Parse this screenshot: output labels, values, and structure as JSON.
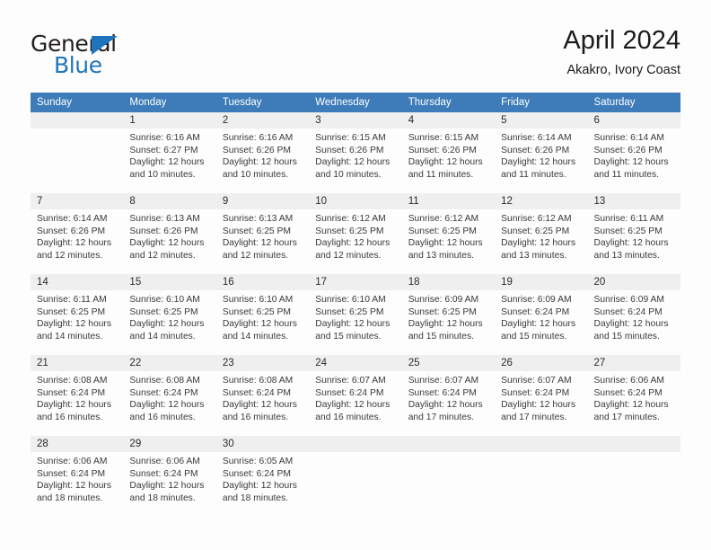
{
  "brand": {
    "name_top": "General",
    "name_bottom": "Blue",
    "triangle_color": "#1f74bb"
  },
  "header": {
    "month_title": "April 2024",
    "location": "Akakro, Ivory Coast"
  },
  "theme": {
    "header_blue": "#3d7cb8",
    "separator_blue": "#2f6fad",
    "daynum_band": "#efefef",
    "page_background": "#fdfdfd"
  },
  "calendar": {
    "weekday_headers": [
      "Sunday",
      "Monday",
      "Tuesday",
      "Wednesday",
      "Thursday",
      "Friday",
      "Saturday"
    ],
    "weeks": [
      [
        {
          "day": "",
          "blank": true,
          "sunrise": "",
          "sunset": "",
          "daylight_line1": "",
          "daylight_line2": ""
        },
        {
          "day": "1",
          "sunrise": "Sunrise: 6:16 AM",
          "sunset": "Sunset: 6:27 PM",
          "daylight_line1": "Daylight: 12 hours",
          "daylight_line2": "and 10 minutes."
        },
        {
          "day": "2",
          "sunrise": "Sunrise: 6:16 AM",
          "sunset": "Sunset: 6:26 PM",
          "daylight_line1": "Daylight: 12 hours",
          "daylight_line2": "and 10 minutes."
        },
        {
          "day": "3",
          "sunrise": "Sunrise: 6:15 AM",
          "sunset": "Sunset: 6:26 PM",
          "daylight_line1": "Daylight: 12 hours",
          "daylight_line2": "and 10 minutes."
        },
        {
          "day": "4",
          "sunrise": "Sunrise: 6:15 AM",
          "sunset": "Sunset: 6:26 PM",
          "daylight_line1": "Daylight: 12 hours",
          "daylight_line2": "and 11 minutes."
        },
        {
          "day": "5",
          "sunrise": "Sunrise: 6:14 AM",
          "sunset": "Sunset: 6:26 PM",
          "daylight_line1": "Daylight: 12 hours",
          "daylight_line2": "and 11 minutes."
        },
        {
          "day": "6",
          "sunrise": "Sunrise: 6:14 AM",
          "sunset": "Sunset: 6:26 PM",
          "daylight_line1": "Daylight: 12 hours",
          "daylight_line2": "and 11 minutes."
        }
      ],
      [
        {
          "day": "7",
          "sunrise": "Sunrise: 6:14 AM",
          "sunset": "Sunset: 6:26 PM",
          "daylight_line1": "Daylight: 12 hours",
          "daylight_line2": "and 12 minutes."
        },
        {
          "day": "8",
          "sunrise": "Sunrise: 6:13 AM",
          "sunset": "Sunset: 6:26 PM",
          "daylight_line1": "Daylight: 12 hours",
          "daylight_line2": "and 12 minutes."
        },
        {
          "day": "9",
          "sunrise": "Sunrise: 6:13 AM",
          "sunset": "Sunset: 6:25 PM",
          "daylight_line1": "Daylight: 12 hours",
          "daylight_line2": "and 12 minutes."
        },
        {
          "day": "10",
          "sunrise": "Sunrise: 6:12 AM",
          "sunset": "Sunset: 6:25 PM",
          "daylight_line1": "Daylight: 12 hours",
          "daylight_line2": "and 12 minutes."
        },
        {
          "day": "11",
          "sunrise": "Sunrise: 6:12 AM",
          "sunset": "Sunset: 6:25 PM",
          "daylight_line1": "Daylight: 12 hours",
          "daylight_line2": "and 13 minutes."
        },
        {
          "day": "12",
          "sunrise": "Sunrise: 6:12 AM",
          "sunset": "Sunset: 6:25 PM",
          "daylight_line1": "Daylight: 12 hours",
          "daylight_line2": "and 13 minutes."
        },
        {
          "day": "13",
          "sunrise": "Sunrise: 6:11 AM",
          "sunset": "Sunset: 6:25 PM",
          "daylight_line1": "Daylight: 12 hours",
          "daylight_line2": "and 13 minutes."
        }
      ],
      [
        {
          "day": "14",
          "sunrise": "Sunrise: 6:11 AM",
          "sunset": "Sunset: 6:25 PM",
          "daylight_line1": "Daylight: 12 hours",
          "daylight_line2": "and 14 minutes."
        },
        {
          "day": "15",
          "sunrise": "Sunrise: 6:10 AM",
          "sunset": "Sunset: 6:25 PM",
          "daylight_line1": "Daylight: 12 hours",
          "daylight_line2": "and 14 minutes."
        },
        {
          "day": "16",
          "sunrise": "Sunrise: 6:10 AM",
          "sunset": "Sunset: 6:25 PM",
          "daylight_line1": "Daylight: 12 hours",
          "daylight_line2": "and 14 minutes."
        },
        {
          "day": "17",
          "sunrise": "Sunrise: 6:10 AM",
          "sunset": "Sunset: 6:25 PM",
          "daylight_line1": "Daylight: 12 hours",
          "daylight_line2": "and 15 minutes."
        },
        {
          "day": "18",
          "sunrise": "Sunrise: 6:09 AM",
          "sunset": "Sunset: 6:25 PM",
          "daylight_line1": "Daylight: 12 hours",
          "daylight_line2": "and 15 minutes."
        },
        {
          "day": "19",
          "sunrise": "Sunrise: 6:09 AM",
          "sunset": "Sunset: 6:24 PM",
          "daylight_line1": "Daylight: 12 hours",
          "daylight_line2": "and 15 minutes."
        },
        {
          "day": "20",
          "sunrise": "Sunrise: 6:09 AM",
          "sunset": "Sunset: 6:24 PM",
          "daylight_line1": "Daylight: 12 hours",
          "daylight_line2": "and 15 minutes."
        }
      ],
      [
        {
          "day": "21",
          "sunrise": "Sunrise: 6:08 AM",
          "sunset": "Sunset: 6:24 PM",
          "daylight_line1": "Daylight: 12 hours",
          "daylight_line2": "and 16 minutes."
        },
        {
          "day": "22",
          "sunrise": "Sunrise: 6:08 AM",
          "sunset": "Sunset: 6:24 PM",
          "daylight_line1": "Daylight: 12 hours",
          "daylight_line2": "and 16 minutes."
        },
        {
          "day": "23",
          "sunrise": "Sunrise: 6:08 AM",
          "sunset": "Sunset: 6:24 PM",
          "daylight_line1": "Daylight: 12 hours",
          "daylight_line2": "and 16 minutes."
        },
        {
          "day": "24",
          "sunrise": "Sunrise: 6:07 AM",
          "sunset": "Sunset: 6:24 PM",
          "daylight_line1": "Daylight: 12 hours",
          "daylight_line2": "and 16 minutes."
        },
        {
          "day": "25",
          "sunrise": "Sunrise: 6:07 AM",
          "sunset": "Sunset: 6:24 PM",
          "daylight_line1": "Daylight: 12 hours",
          "daylight_line2": "and 17 minutes."
        },
        {
          "day": "26",
          "sunrise": "Sunrise: 6:07 AM",
          "sunset": "Sunset: 6:24 PM",
          "daylight_line1": "Daylight: 12 hours",
          "daylight_line2": "and 17 minutes."
        },
        {
          "day": "27",
          "sunrise": "Sunrise: 6:06 AM",
          "sunset": "Sunset: 6:24 PM",
          "daylight_line1": "Daylight: 12 hours",
          "daylight_line2": "and 17 minutes."
        }
      ],
      [
        {
          "day": "28",
          "sunrise": "Sunrise: 6:06 AM",
          "sunset": "Sunset: 6:24 PM",
          "daylight_line1": "Daylight: 12 hours",
          "daylight_line2": "and 18 minutes."
        },
        {
          "day": "29",
          "sunrise": "Sunrise: 6:06 AM",
          "sunset": "Sunset: 6:24 PM",
          "daylight_line1": "Daylight: 12 hours",
          "daylight_line2": "and 18 minutes."
        },
        {
          "day": "30",
          "sunrise": "Sunrise: 6:05 AM",
          "sunset": "Sunset: 6:24 PM",
          "daylight_line1": "Daylight: 12 hours",
          "daylight_line2": "and 18 minutes."
        },
        {
          "day": "",
          "blank": true,
          "sunrise": "",
          "sunset": "",
          "daylight_line1": "",
          "daylight_line2": ""
        },
        {
          "day": "",
          "blank": true,
          "sunrise": "",
          "sunset": "",
          "daylight_line1": "",
          "daylight_line2": ""
        },
        {
          "day": "",
          "blank": true,
          "sunrise": "",
          "sunset": "",
          "daylight_line1": "",
          "daylight_line2": ""
        },
        {
          "day": "",
          "blank": true,
          "sunrise": "",
          "sunset": "",
          "daylight_line1": "",
          "daylight_line2": ""
        }
      ]
    ]
  }
}
